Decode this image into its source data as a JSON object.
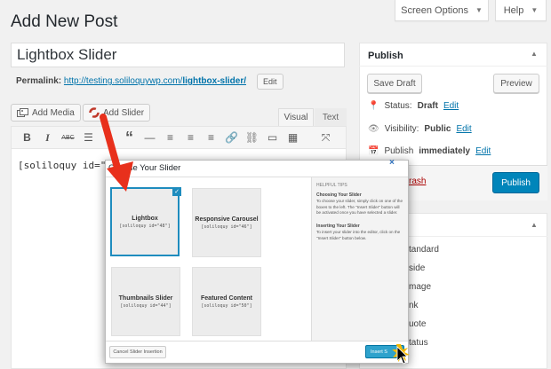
{
  "header": {
    "title": "Add New Post",
    "screen_options": "Screen Options",
    "help": "Help"
  },
  "post": {
    "title": "Lightbox Slider",
    "permalink_label": "Permalink:",
    "permalink_base": "http://testing.soliloquywp.com/",
    "permalink_slug": "lightbox-slider/",
    "edit_label": "Edit"
  },
  "media_buttons": {
    "add_media": "Add Media",
    "add_slider": "Add Slider"
  },
  "editor": {
    "tab_visual": "Visual",
    "tab_text": "Text",
    "content": "[soliloquy id=\"48\"]",
    "toolbar_icons": [
      "bold-icon",
      "italic-icon",
      "strikethrough-icon",
      "bullet-list-icon",
      "numbered-list-icon",
      "blockquote-icon",
      "horizontal-rule-icon",
      "align-left-icon",
      "align-center-icon",
      "align-right-icon",
      "link-icon",
      "unlink-icon",
      "read-more-icon",
      "toolbar-toggle-icon",
      "fullscreen-icon"
    ]
  },
  "publish": {
    "title": "Publish",
    "save_draft": "Save Draft",
    "preview": "Preview",
    "status_label": "Status:",
    "status_value": "Draft",
    "visibility_label": "Visibility:",
    "visibility_value": "Public",
    "publish_label": "Publish",
    "publish_value": "immediately",
    "edit": "Edit",
    "trash": "rash",
    "publish_button": "Publish"
  },
  "format": {
    "items": [
      "tandard",
      "side",
      "mage",
      "nk",
      "uote",
      "tatus"
    ]
  },
  "modal": {
    "title": "Choose Your Slider",
    "close": "×",
    "sliders": [
      {
        "name": "Lightbox",
        "code": "[soliloquy id=\"48\"]",
        "selected": true
      },
      {
        "name": "Responsive Carousel",
        "code": "[soliloquy id=\"46\"]",
        "selected": false
      },
      {
        "name": "Thumbnails Slider",
        "code": "[soliloquy id=\"44\"]",
        "selected": false
      },
      {
        "name": "Featured Content",
        "code": "[soliloquy id=\"50\"]",
        "selected": false
      }
    ],
    "help": {
      "heading": "HELPFUL TIPS",
      "choose_title": "Choosing Your Slider",
      "choose_text": "To choose your slider, simply click on one of the boxes to the left. The \"Insert Slider\" button will be activated once you have selected a slider.",
      "insert_title": "Inserting Your Slider",
      "insert_text": "To insert your slider into the editor, click on the \"Insert Slider\" button below."
    },
    "cancel": "Cancel Slider Insertion",
    "insert": "Insert S"
  },
  "colors": {
    "link": "#0073aa",
    "primary": "#0085ba",
    "selected_border": "#1e8cbe",
    "trash": "#a00",
    "arrow": "#e8301c"
  }
}
